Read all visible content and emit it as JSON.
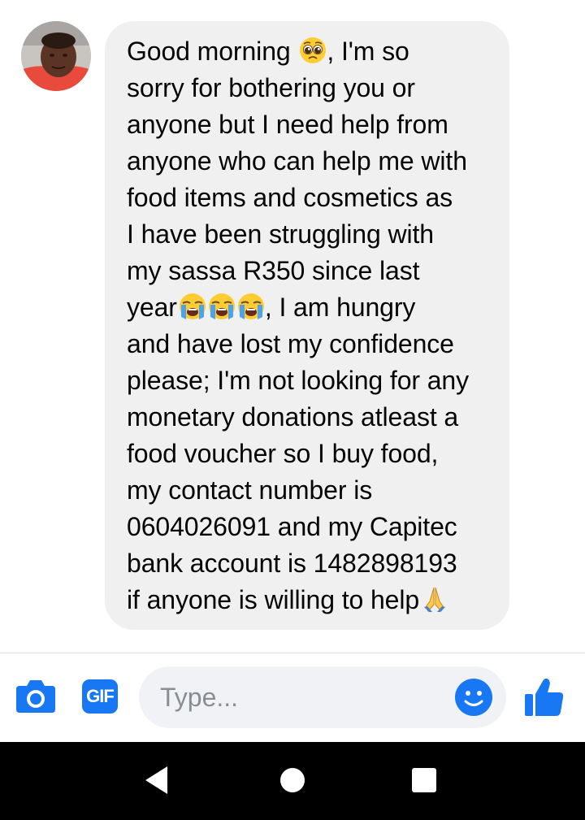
{
  "conversation": {
    "message_lines": [
      "Good morning",
      ", I'm so",
      "sorry for bothering you or",
      "anyone but I need help from",
      "anyone who can help me with",
      "food items and cosmetics as",
      "I have been struggling with",
      "my sassa R350 since last",
      "year",
      ", I am hungry",
      "and have lost my confidence",
      "please; I'm not looking for any",
      "monetary donations atleast a",
      "food voucher so I buy food,",
      "my contact number is",
      "0604026091 and my Capitec",
      "bank account is 1482898193",
      "if anyone is willing to help"
    ],
    "emojis": {
      "line1": "pleading-face-emoji",
      "line8": [
        "loudly-crying-face-emoji",
        "loudly-crying-face-emoji",
        "loudly-crying-face-emoji"
      ],
      "line16": "folded-hands-emoji"
    }
  },
  "composer": {
    "placeholder": "Type...",
    "gif_label": "GIF",
    "icons": [
      "camera-icon",
      "gif-icon",
      "emoji-icon",
      "thumbs-up-icon"
    ]
  },
  "navbar": {
    "icons": [
      "back-icon",
      "home-icon",
      "recents-icon"
    ]
  },
  "colors": {
    "accent": "#1877f2",
    "bubble": "#f0f0f0",
    "input_bg": "#f0f2f5",
    "text": "#050505",
    "placeholder": "#8a8d91",
    "navbar": "#000000"
  }
}
